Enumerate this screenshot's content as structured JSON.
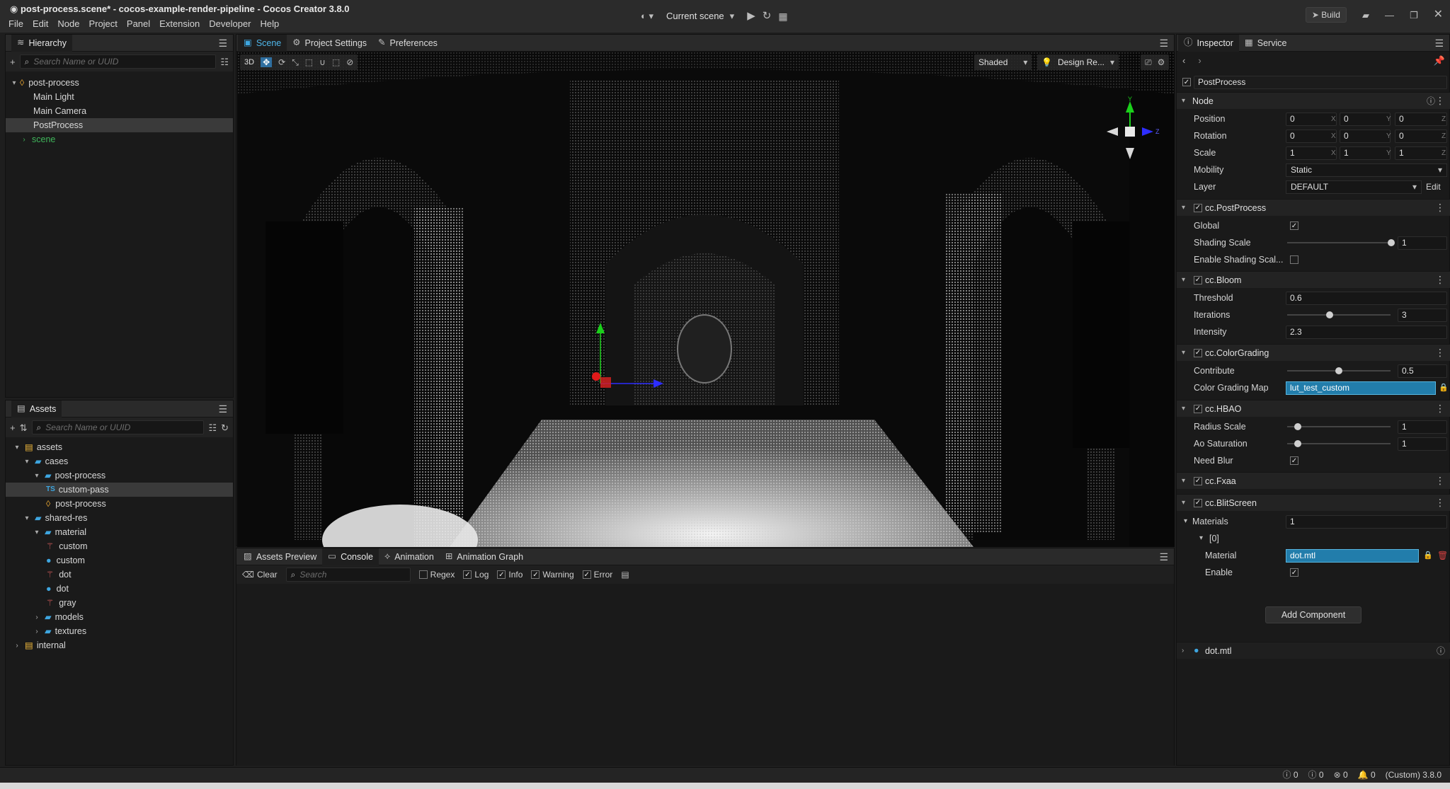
{
  "window": {
    "title": "post-process.scene* - cocos-example-render-pipeline - Cocos Creator 3.8.0",
    "menu": [
      "File",
      "Edit",
      "Node",
      "Project",
      "Panel",
      "Extension",
      "Developer",
      "Help"
    ],
    "scene_select": "Current scene",
    "build_label": "Build"
  },
  "hierarchy": {
    "title": "Hierarchy",
    "search_placeholder": "Search Name or UUID",
    "root": "post-process",
    "children": [
      "Main Light",
      "Main Camera",
      "PostProcess"
    ],
    "scene_node": "scene"
  },
  "assets": {
    "title": "Assets",
    "search_placeholder": "Search Name or UUID",
    "items": [
      {
        "label": "assets",
        "kind": "db"
      },
      {
        "label": "cases",
        "kind": "folder"
      },
      {
        "label": "post-process",
        "kind": "folder"
      },
      {
        "label": "custom-pass",
        "kind": "ts"
      },
      {
        "label": "post-process",
        "kind": "scene"
      },
      {
        "label": "shared-res",
        "kind": "folder"
      },
      {
        "label": "material",
        "kind": "folder"
      },
      {
        "label": "custom",
        "kind": "effect"
      },
      {
        "label": "custom",
        "kind": "material"
      },
      {
        "label": "dot",
        "kind": "effect"
      },
      {
        "label": "dot",
        "kind": "material"
      },
      {
        "label": "gray",
        "kind": "effect"
      },
      {
        "label": "models",
        "kind": "folder"
      },
      {
        "label": "textures",
        "kind": "folder"
      },
      {
        "label": "internal",
        "kind": "db"
      }
    ]
  },
  "scene": {
    "tabs": [
      "Scene",
      "Project Settings",
      "Preferences"
    ],
    "mode_3d": "3D",
    "shading": "Shaded",
    "resolution": "Design Re...",
    "gizmo_axes": {
      "y": "Y",
      "z": "Z"
    }
  },
  "console": {
    "tabs": [
      "Assets Preview",
      "Console",
      "Animation",
      "Animation Graph"
    ],
    "clear_label": "Clear",
    "search_placeholder": "Search",
    "filters": [
      "Regex",
      "Log",
      "Info",
      "Warning",
      "Error"
    ]
  },
  "inspector": {
    "tabs": [
      "Inspector",
      "Service"
    ],
    "node_name": "PostProcess",
    "node_section": "Node",
    "position": {
      "label": "Position",
      "x": "0",
      "y": "0",
      "z": "0"
    },
    "rotation": {
      "label": "Rotation",
      "x": "0",
      "y": "0",
      "z": "0"
    },
    "scale": {
      "label": "Scale",
      "x": "1",
      "y": "1",
      "z": "1"
    },
    "axis_labels": {
      "x": "X",
      "y": "Y",
      "z": "Z"
    },
    "mobility": {
      "label": "Mobility",
      "value": "Static"
    },
    "layer": {
      "label": "Layer",
      "value": "DEFAULT",
      "edit": "Edit"
    },
    "post_process": {
      "name": "cc.PostProcess",
      "global_label": "Global",
      "shading_scale_label": "Shading Scale",
      "shading_scale": "1",
      "enable_shading_label": "Enable Shading Scal..."
    },
    "bloom": {
      "name": "cc.Bloom",
      "threshold_label": "Threshold",
      "threshold": "0.6",
      "iterations_label": "Iterations",
      "iterations": "3",
      "intensity_label": "Intensity",
      "intensity": "2.3"
    },
    "color_grading": {
      "name": "cc.ColorGrading",
      "contribute_label": "Contribute",
      "contribute": "0.5",
      "map_label": "Color Grading Map",
      "map": "lut_test_custom"
    },
    "hbao": {
      "name": "cc.HBAO",
      "radius_label": "Radius Scale",
      "radius": "1",
      "ao_label": "Ao Saturation",
      "ao": "1",
      "blur_label": "Need Blur"
    },
    "fxaa": {
      "name": "cc.Fxaa"
    },
    "blit": {
      "name": "cc.BlitScreen",
      "materials_label": "Materials",
      "materials_count": "1",
      "index": "[0]",
      "material_label": "Material",
      "material": "dot.mtl",
      "enable_label": "Enable"
    },
    "add_component": "Add Component",
    "asset_preview": "dot.mtl"
  },
  "status": {
    "log_count": "0",
    "info_count": "0",
    "error_count": "0",
    "notif_count": "0",
    "version": "(Custom) 3.8.0"
  }
}
